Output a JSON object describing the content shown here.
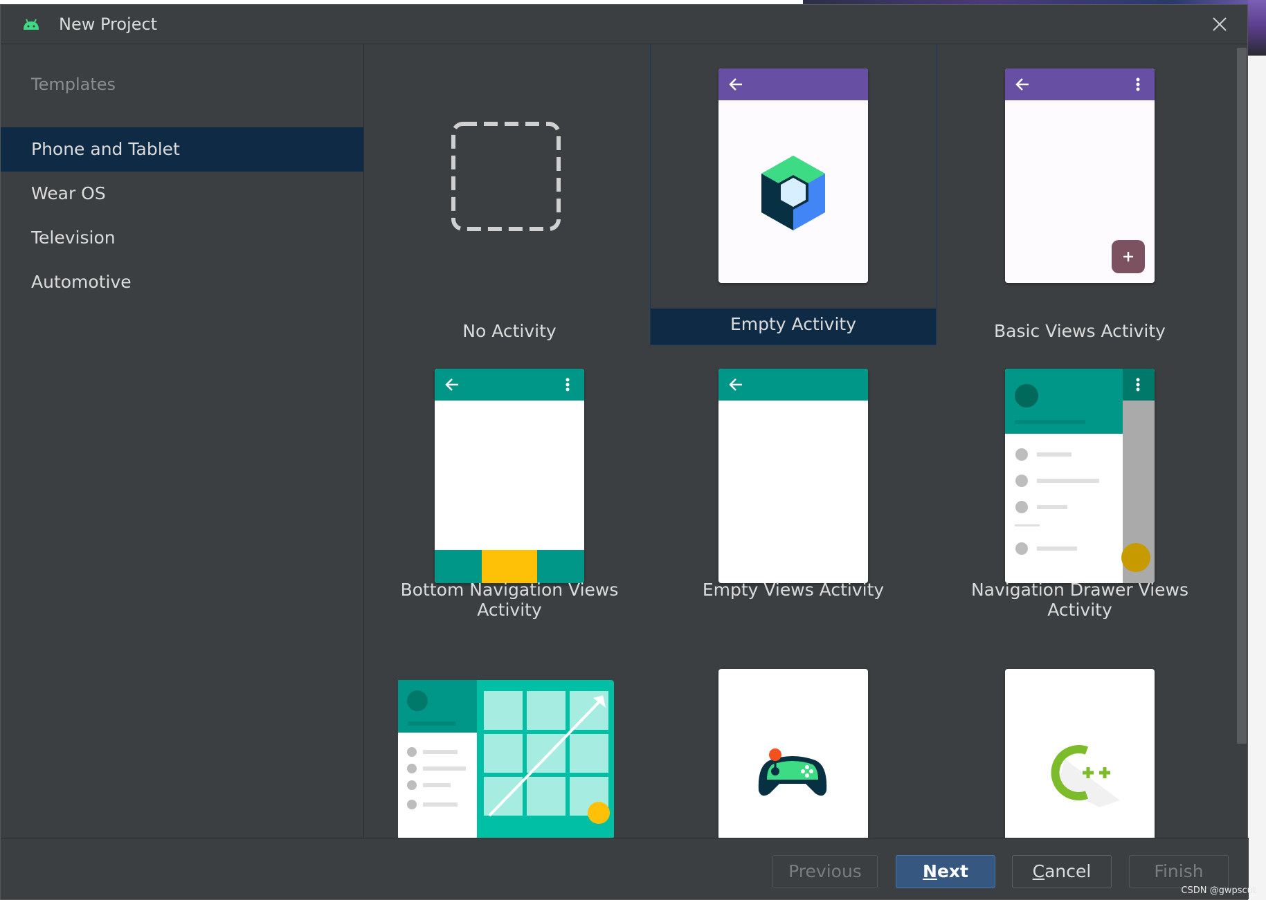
{
  "window": {
    "title": "New Project"
  },
  "sidebar": {
    "header": "Templates",
    "items": [
      {
        "label": "Phone and Tablet",
        "selected": true
      },
      {
        "label": "Wear OS",
        "selected": false
      },
      {
        "label": "Television",
        "selected": false
      },
      {
        "label": "Automotive",
        "selected": false
      }
    ]
  },
  "templates": [
    {
      "label": "No Activity",
      "icon": "dashed-square-icon"
    },
    {
      "label": "Empty Activity",
      "icon": "compose-hexagon-icon",
      "selected": true
    },
    {
      "label": "Basic Views Activity",
      "icon": "fab-plus-icon"
    },
    {
      "label": "Bottom Navigation Views Activity",
      "icon": "bottom-nav-icon"
    },
    {
      "label": "Empty Views Activity",
      "icon": "blank-screen-icon"
    },
    {
      "label": "Navigation Drawer Views Activity",
      "icon": "nav-drawer-icon"
    },
    {
      "label": "",
      "icon": "responsive-grid-icon"
    },
    {
      "label": "",
      "icon": "game-controller-icon"
    },
    {
      "label": "",
      "icon": "cpp-icon"
    }
  ],
  "footer": {
    "previous": "Previous",
    "next_mnemonic": "N",
    "next_rest": "ext",
    "cancel_mnemonic": "C",
    "cancel_rest": "ancel",
    "finish": "Finish"
  },
  "watermark": "CSDN @gwpscut",
  "colors": {
    "dialog_bg": "#3c3f41",
    "selection": "#0e2a44",
    "purple_bar": "#6750a4",
    "teal_bar": "#009688",
    "accent_yellow": "#ffc107",
    "primary_button": "#365880"
  }
}
